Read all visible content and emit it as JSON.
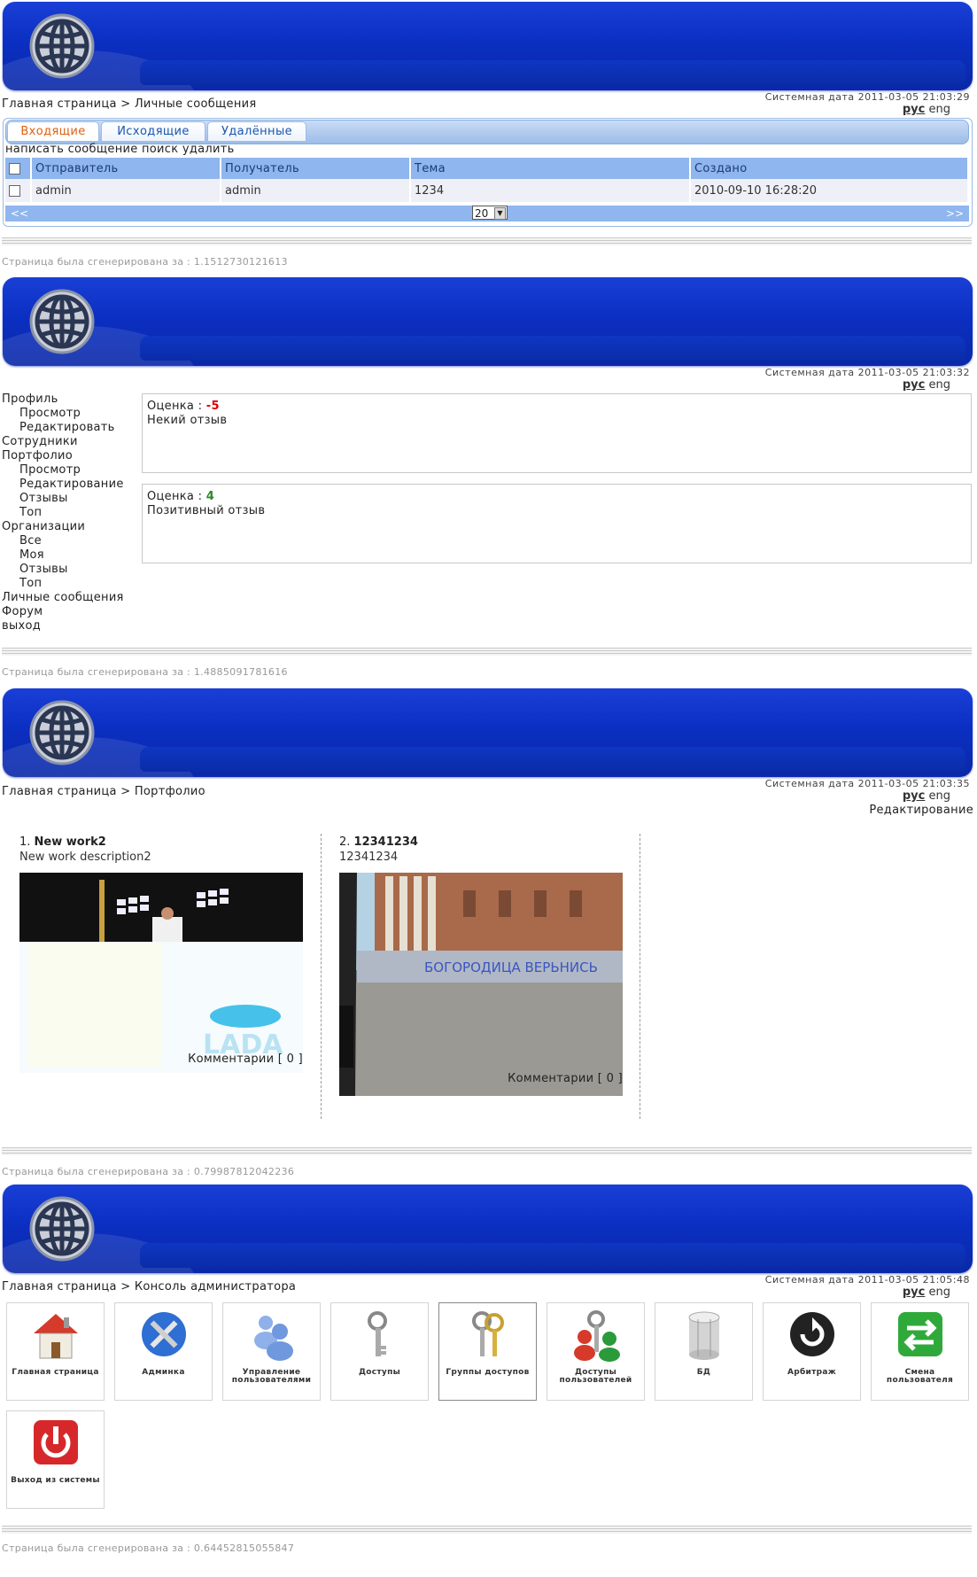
{
  "pages": [
    {
      "sysdate": "Системная дата 2011-03-05 21:03:29",
      "lang": {
        "ru": "рус",
        "en": "eng"
      },
      "breadcrumb": "Главная страница > Личные сообщения",
      "generated": "Страница была сгенерирована за : 1.1512730121613"
    },
    {
      "sysdate": "Системная дата 2011-03-05 21:03:32",
      "lang": {
        "ru": "рус",
        "en": "eng"
      },
      "generated": "Страница была сгенерирована за : 1.4885091781616"
    },
    {
      "sysdate": "Системная дата 2011-03-05 21:03:35",
      "lang": {
        "ru": "рус",
        "en": "eng"
      },
      "breadcrumb": "Главная страница > Портфолио",
      "edit_link": "Редактирование",
      "generated": "Страница была сгенерирована за : 0.79987812042236"
    },
    {
      "sysdate": "Системная дата 2011-03-05 21:05:48",
      "lang": {
        "ru": "рус",
        "en": "eng"
      },
      "breadcrumb": "Главная страница > Консоль администратора",
      "generated": "Страница была сгенерирована за : 0.64452815055847"
    }
  ],
  "mail": {
    "tabs": [
      "Входящие",
      "Исходящие",
      "Удалённые"
    ],
    "actions": "написать сообщение поиск удалить",
    "columns": [
      "Отправитель",
      "Получатель",
      "Тема",
      "Создано"
    ],
    "rows": [
      {
        "sender": "admin",
        "recipient": "admin",
        "subject": "1234",
        "created": "2010-09-10 16:28:20"
      }
    ],
    "pager": {
      "prev": "<<",
      "next": ">>",
      "page_size": "20"
    }
  },
  "sidebar": [
    {
      "label": "Профиль",
      "level": 0
    },
    {
      "label": "Просмотр",
      "level": 1
    },
    {
      "label": "Редактировать",
      "level": 1
    },
    {
      "label": "Сотрудники",
      "level": 0
    },
    {
      "label": "Портфолио",
      "level": 0
    },
    {
      "label": "Просмотр",
      "level": 1
    },
    {
      "label": "Редактирование",
      "level": 1
    },
    {
      "label": "Отзывы",
      "level": 1
    },
    {
      "label": "Топ",
      "level": 1
    },
    {
      "label": "Организации",
      "level": 0
    },
    {
      "label": "Все",
      "level": 1
    },
    {
      "label": "Моя",
      "level": 1
    },
    {
      "label": "Отзывы",
      "level": 1
    },
    {
      "label": "Топ",
      "level": 1
    },
    {
      "label": "Личные сообщения",
      "level": 0
    },
    {
      "label": "Форум",
      "level": 0
    },
    {
      "label": "выход",
      "level": 0
    }
  ],
  "reviews": [
    {
      "score_label": "Оценка :",
      "score": "-5",
      "text": "Некий отзыв",
      "color": "#dd0000"
    },
    {
      "score_label": "Оценка :",
      "score": "4",
      "text": "Позитивный отзыв",
      "color": "#2a8a2a"
    }
  ],
  "portfolio": [
    {
      "num": "1.",
      "title": "New work2",
      "desc": "New work description2",
      "comments": "Комментарии [ 0 ]",
      "image_text": "LADA"
    },
    {
      "num": "2.",
      "title": "12341234",
      "desc": "12341234",
      "comments": "Комментарии [ 0 ]",
      "image_text": "БОГОРОДИЦА ВЕРЬНИСЬ"
    }
  ],
  "admin_tiles": [
    {
      "label": "Главная страница",
      "icon": "home-icon"
    },
    {
      "label": "Админка",
      "icon": "tools-icon"
    },
    {
      "label": "Управление пользователями",
      "icon": "users-icon"
    },
    {
      "label": "Доступы",
      "icon": "key-icon"
    },
    {
      "label": "Группы доступов",
      "icon": "keys-icon"
    },
    {
      "label": "Доступы пользователей",
      "icon": "user-keys-icon"
    },
    {
      "label": "БД",
      "icon": "database-icon"
    },
    {
      "label": "Арбитраж",
      "icon": "refresh-icon"
    },
    {
      "label": "Смена пользователя",
      "icon": "switch-user-icon"
    },
    {
      "label": "Выход из системы",
      "icon": "power-icon"
    }
  ]
}
